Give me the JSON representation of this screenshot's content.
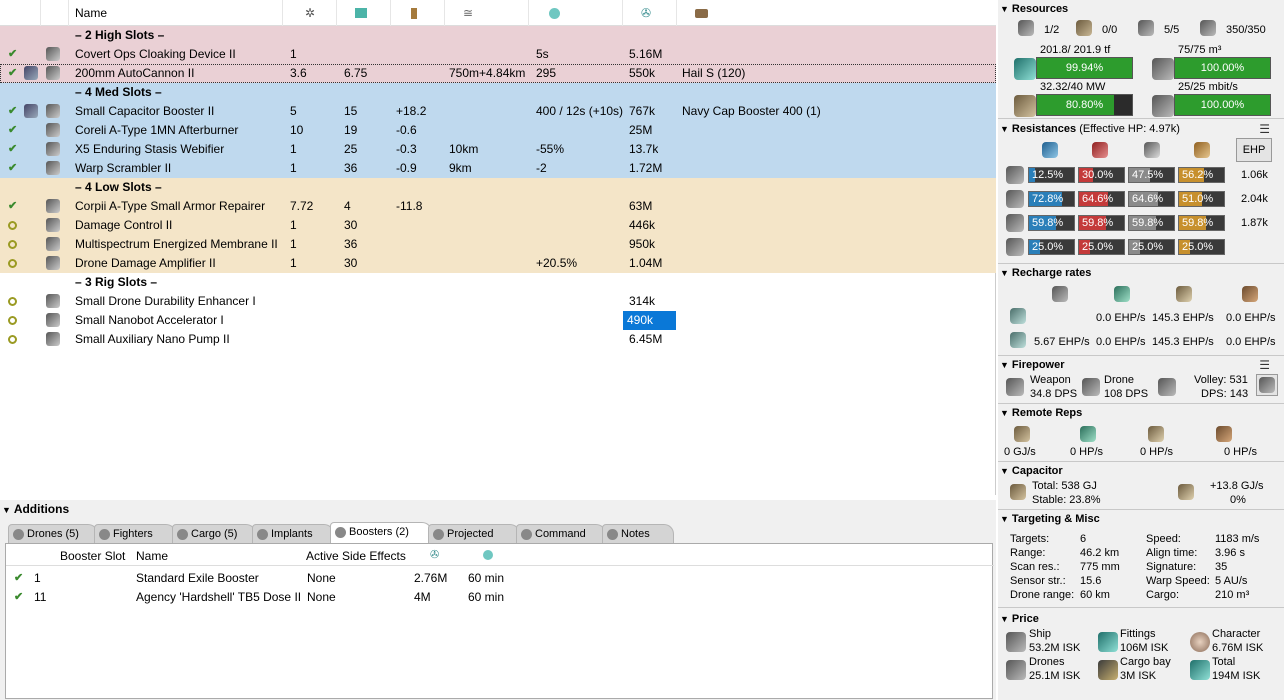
{
  "columns": {
    "name": "Name"
  },
  "slot_rows": [
    {
      "type": "header",
      "cls": "hs",
      "label": "– 2 High Slots –"
    },
    {
      "type": "mod",
      "cls": "hs",
      "state": "check",
      "charge_icon": false,
      "name": "Covert Ops Cloaking Device II",
      "c1": "1",
      "c2": "",
      "c3": "",
      "c4": "",
      "c5": "5s",
      "c6": "5.16M",
      "c7": ""
    },
    {
      "type": "mod",
      "cls": "hs",
      "state": "check",
      "charge_icon": true,
      "dotted": true,
      "name": "200mm AutoCannon II",
      "c1": "3.6",
      "c2": "6.75",
      "c3": "",
      "c4": "750m+4.84km",
      "c5": "295",
      "c6": "550k",
      "c7": "Hail S (120)"
    },
    {
      "type": "header",
      "cls": "ms",
      "label": "– 4 Med Slots –"
    },
    {
      "type": "mod",
      "cls": "ms",
      "state": "check",
      "charge_icon": true,
      "name": "Small Capacitor Booster II",
      "c1": "5",
      "c2": "15",
      "c3": "+18.2",
      "c4": "",
      "c5": "400 / 12s (+10s)",
      "c6": "767k",
      "c7": "Navy Cap Booster 400 (1)"
    },
    {
      "type": "mod",
      "cls": "ms",
      "state": "check",
      "charge_icon": false,
      "name": "Coreli A-Type 1MN Afterburner",
      "c1": "10",
      "c2": "19",
      "c3": "-0.6",
      "c4": "",
      "c5": "",
      "c6": "25M",
      "c7": ""
    },
    {
      "type": "mod",
      "cls": "ms",
      "state": "check",
      "charge_icon": false,
      "name": "X5 Enduring Stasis Webifier",
      "c1": "1",
      "c2": "25",
      "c3": "-0.3",
      "c4": "10km",
      "c5": "-55%",
      "c6": "13.7k",
      "c7": ""
    },
    {
      "type": "mod",
      "cls": "ms",
      "state": "check",
      "charge_icon": false,
      "name": "Warp Scrambler II",
      "c1": "1",
      "c2": "36",
      "c3": "-0.9",
      "c4": "9km",
      "c5": "-2",
      "c6": "1.72M",
      "c7": ""
    },
    {
      "type": "header",
      "cls": "ls",
      "label": "– 4 Low Slots –"
    },
    {
      "type": "mod",
      "cls": "ls",
      "state": "check",
      "charge_icon": false,
      "name": "Corpii A-Type Small Armor Repairer",
      "c1": "7.72",
      "c2": "4",
      "c3": "-11.8",
      "c4": "",
      "c5": "",
      "c6": "63M",
      "c7": ""
    },
    {
      "type": "mod",
      "cls": "ls",
      "state": "ring",
      "charge_icon": false,
      "name": "Damage Control II",
      "c1": "1",
      "c2": "30",
      "c3": "",
      "c4": "",
      "c5": "",
      "c6": "446k",
      "c7": ""
    },
    {
      "type": "mod",
      "cls": "ls",
      "state": "ring",
      "charge_icon": false,
      "name": "Multispectrum Energized Membrane II",
      "c1": "1",
      "c2": "36",
      "c3": "",
      "c4": "",
      "c5": "",
      "c6": "950k",
      "c7": ""
    },
    {
      "type": "mod",
      "cls": "ls",
      "state": "ring",
      "charge_icon": false,
      "name": "Drone Damage Amplifier II",
      "c1": "1",
      "c2": "30",
      "c3": "",
      "c4": "",
      "c5": "+20.5%",
      "c6": "1.04M",
      "c7": ""
    },
    {
      "type": "header",
      "cls": "",
      "label": "– 3 Rig Slots –"
    },
    {
      "type": "mod",
      "cls": "",
      "state": "ring",
      "charge_icon": false,
      "name": "Small Drone Durability Enhancer I",
      "c1": "",
      "c2": "",
      "c3": "",
      "c4": "",
      "c5": "",
      "c6": "314k",
      "c7": ""
    },
    {
      "type": "mod",
      "cls": "",
      "state": "ring",
      "charge_icon": false,
      "selected": true,
      "name": "Small Nanobot Accelerator I",
      "c1": "",
      "c2": "",
      "c3": "",
      "c4": "",
      "c5": "",
      "c6": "490k",
      "c7": ""
    },
    {
      "type": "mod",
      "cls": "",
      "state": "ring",
      "charge_icon": false,
      "name": "Small Auxiliary Nano Pump II",
      "c1": "",
      "c2": "",
      "c3": "",
      "c4": "",
      "c5": "",
      "c6": "6.45M",
      "c7": ""
    }
  ],
  "additions": {
    "title": "Additions",
    "tabs": [
      "Drones (5)",
      "Fighters",
      "Cargo (5)",
      "Implants",
      "Boosters (2)",
      "Projected",
      "Command",
      "Notes"
    ],
    "booster_headers": {
      "slot": "Booster Slot",
      "name": "Name",
      "side": "Active Side Effects"
    },
    "boosters": [
      {
        "slot": "1",
        "name": "Standard Exile Booster",
        "side": "None",
        "price": "2.76M",
        "dur": "60 min"
      },
      {
        "slot": "11",
        "name": "Agency 'Hardshell' TB5 Dose II",
        "side": "None",
        "price": "4M",
        "dur": "60 min"
      }
    ]
  },
  "resources": {
    "title": "Resources",
    "turrets": "1/2",
    "launchers": "0/0",
    "drones_active": "5/5",
    "drone_bay": "350/350",
    "cpu_label": "201.8/ 201.9 tf",
    "cpu_pct": "99.94%",
    "cpu_frac": 0.9994,
    "drone_bw_label": "75/75 m³",
    "drone_bw_pct": "100.00%",
    "drone_bw_frac": 1.0,
    "pg_label": "32.32/40 MW",
    "pg_pct": "80.80%",
    "pg_frac": 0.808,
    "dcap_label": "25/25 mbit/s",
    "dcap_pct": "100.00%",
    "dcap_frac": 1.0
  },
  "resistances": {
    "title": "Resistances",
    "ehp_text": "(Effective HP: 4.97k)",
    "ehp_button": "EHP",
    "rows": [
      {
        "vals": [
          "12.5%",
          "30.0%",
          "47.5%",
          "56.2%"
        ],
        "fr": [
          0.125,
          0.3,
          0.475,
          0.562
        ],
        "hp": "1.06k"
      },
      {
        "vals": [
          "72.8%",
          "64.6%",
          "64.6%",
          "51.0%"
        ],
        "fr": [
          0.728,
          0.646,
          0.646,
          0.51
        ],
        "hp": "2.04k"
      },
      {
        "vals": [
          "59.8%",
          "59.8%",
          "59.8%",
          "59.8%"
        ],
        "fr": [
          0.598,
          0.598,
          0.598,
          0.598
        ],
        "hp": "1.87k"
      },
      {
        "vals": [
          "25.0%",
          "25.0%",
          "25.0%",
          "25.0%"
        ],
        "fr": [
          0.25,
          0.25,
          0.25,
          0.25
        ],
        "hp": ""
      }
    ],
    "colors": [
      "#2a7fb9",
      "#c43a3a",
      "#8a8a8a",
      "#c7902d"
    ]
  },
  "recharge": {
    "title": "Recharge rates",
    "r1": [
      "0.0 EHP/s",
      "145.3 EHP/s",
      "0.0 EHP/s"
    ],
    "r2": [
      "5.67 EHP/s",
      "0.0 EHP/s",
      "145.3 EHP/s",
      "0.0 EHP/s"
    ]
  },
  "firepower": {
    "title": "Firepower",
    "weapon_label": "Weapon",
    "weapon_dps": "34.8 DPS",
    "drone_label": "Drone",
    "drone_dps": "108 DPS",
    "volley": "Volley: 531",
    "dps": "DPS: 143"
  },
  "remote": {
    "title": "Remote Reps",
    "vals": [
      "0 GJ/s",
      "0 HP/s",
      "0 HP/s",
      "0 HP/s"
    ]
  },
  "capacitor": {
    "title": "Capacitor",
    "total": "Total: 538 GJ",
    "stable": "Stable: 23.8%",
    "rate": "+13.8 GJ/s",
    "pct": "0%"
  },
  "targeting": {
    "title": "Targeting & Misc",
    "left": [
      [
        "Targets:",
        "6"
      ],
      [
        "Range:",
        "46.2 km"
      ],
      [
        "Scan res.:",
        "775 mm"
      ],
      [
        "Sensor str.:",
        "15.6"
      ],
      [
        "Drone range:",
        "60 km"
      ]
    ],
    "right": [
      [
        "Speed:",
        "1183 m/s"
      ],
      [
        "Align time:",
        "3.96 s"
      ],
      [
        "Signature:",
        "35"
      ],
      [
        "Warp Speed:",
        "5 AU/s"
      ],
      [
        "Cargo:",
        "210 m³"
      ]
    ]
  },
  "price": {
    "title": "Price",
    "ship_label": "Ship",
    "ship": "53.2M ISK",
    "fit_label": "Fittings",
    "fit": "106M ISK",
    "char_label": "Character",
    "char": "6.76M ISK",
    "drones_label": "Drones",
    "drones": "25.1M ISK",
    "cargo_label": "Cargo bay",
    "cargo": "3M ISK",
    "total_label": "Total",
    "total": "194M ISK"
  }
}
